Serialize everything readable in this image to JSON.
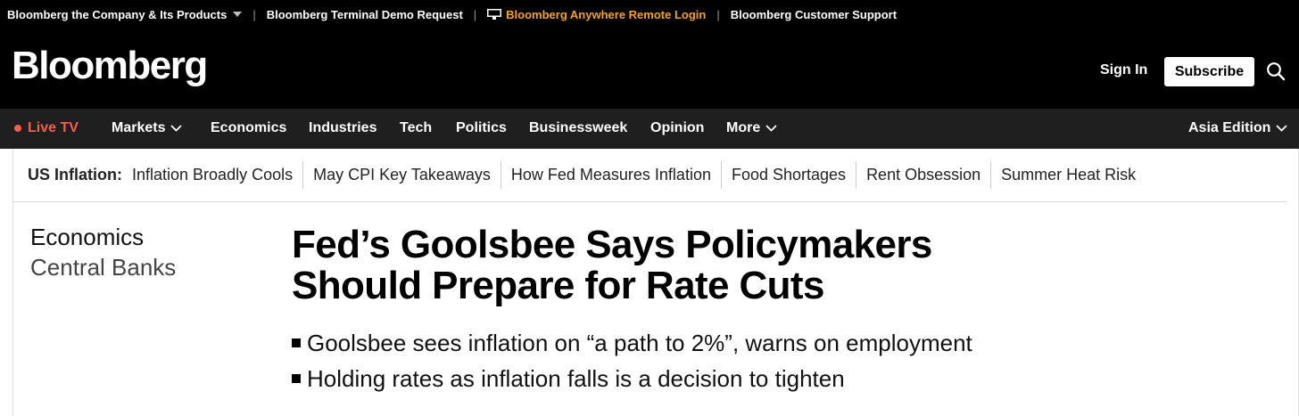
{
  "utility_bar": {
    "items": [
      {
        "label": "Bloomberg the Company & Its Products",
        "icon": "caret-down-icon"
      },
      {
        "label": "Bloomberg Terminal Demo Request"
      },
      {
        "label": "Bloomberg Anywhere Remote Login",
        "icon": "monitor-icon",
        "color": "#f7a21b"
      },
      {
        "label": "Bloomberg Customer Support"
      }
    ]
  },
  "masthead": {
    "logo": "Bloomberg",
    "sign_in": "Sign In",
    "subscribe": "Subscribe",
    "search_icon": "search-icon"
  },
  "nav": {
    "live_tv": "Live TV",
    "items": [
      "Markets",
      "Economics",
      "Industries",
      "Tech",
      "Politics",
      "Businessweek",
      "Opinion",
      "More"
    ],
    "edition": "Asia Edition",
    "live_color": "#ff5a4f"
  },
  "trending": {
    "label": "US Inflation:",
    "links": [
      "Inflation Broadly Cools",
      "May CPI Key Takeaways",
      "How Fed Measures Inflation",
      "Food Shortages",
      "Rent Obsession",
      "Summer Heat Risk"
    ]
  },
  "article": {
    "section": "Economics",
    "subsection": "Central Banks",
    "headline_line1": "Fed’s Goolsbee Says Policymakers",
    "headline_line2": "Should Prepare for Rate Cuts",
    "summary": [
      "Goolsbee sees inflation on “a path to 2%”, warns on employment",
      "Holding rates as inflation falls is a decision to tighten"
    ]
  }
}
